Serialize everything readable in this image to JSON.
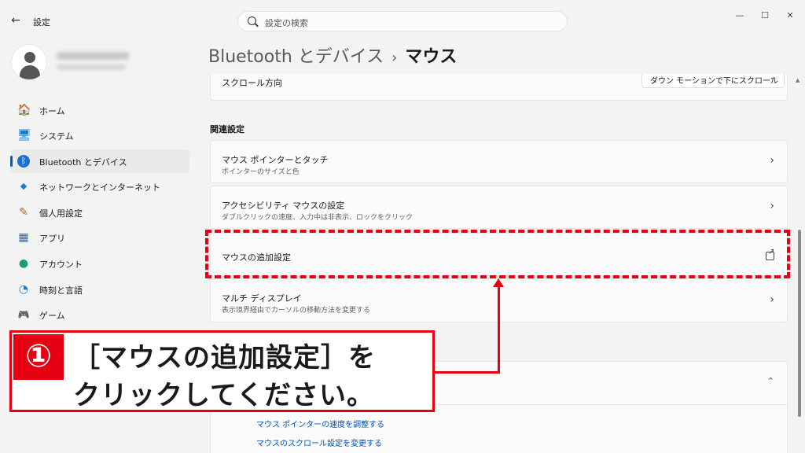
{
  "window": {
    "title": "設定",
    "back_glyph": "←",
    "controls": {
      "minimize": "—",
      "maximize": "☐",
      "close": "✕"
    }
  },
  "search": {
    "placeholder": "設定の検索"
  },
  "sidebar": {
    "items": [
      {
        "label": "ホーム",
        "icon": "home-icon",
        "glyph": "🏠"
      },
      {
        "label": "システム",
        "icon": "monitor-icon",
        "glyph": "🖥"
      },
      {
        "label": "Bluetooth とデバイス",
        "icon": "bluetooth-icon",
        "glyph": "ᛒ",
        "active": true
      },
      {
        "label": "ネットワークとインターネット",
        "icon": "wifi-icon",
        "glyph": "◆"
      },
      {
        "label": "個人用設定",
        "icon": "brush-icon",
        "glyph": "✎"
      },
      {
        "label": "アプリ",
        "icon": "apps-icon",
        "glyph": "▦"
      },
      {
        "label": "アカウント",
        "icon": "person-icon",
        "glyph": "●"
      },
      {
        "label": "時刻と言語",
        "icon": "globe-clock-icon",
        "glyph": "◔"
      },
      {
        "label": "ゲーム",
        "icon": "gamepad-icon",
        "glyph": "🎮"
      }
    ]
  },
  "breadcrumb": {
    "parent": "Bluetooth とデバイス",
    "separator": "›",
    "current": "マウス"
  },
  "scroll_direction": {
    "label": "スクロール方向",
    "value": "ダウン モーションで下にスクロール",
    "chevron": "⌄"
  },
  "related": {
    "heading": "関連設定",
    "items": [
      {
        "title": "マウス ポインターとタッチ",
        "subtitle": "ポインターのサイズと色",
        "chevron": "›"
      },
      {
        "title": "アクセシビリティ マウスの設定",
        "subtitle": "ダブルクリックの速度、入力中は非表示、ロックをクリック",
        "chevron": "›"
      },
      {
        "title": "マウスの追加設定",
        "external": true
      },
      {
        "title": "マルチ ディスプレイ",
        "subtitle": "表示境界経由でカーソルの移動方法を変更する",
        "chevron": "›"
      }
    ]
  },
  "help": {
    "chevron": "⌃",
    "links": [
      "マウス ポインターの速度を調整する",
      "マウスのスクロール設定を変更する"
    ]
  },
  "annotation": {
    "number": "①",
    "line1": "［マウスの追加設定］を",
    "line2": "クリックしてください。",
    "color": "#e50012"
  },
  "accent_color": "#005fb8"
}
